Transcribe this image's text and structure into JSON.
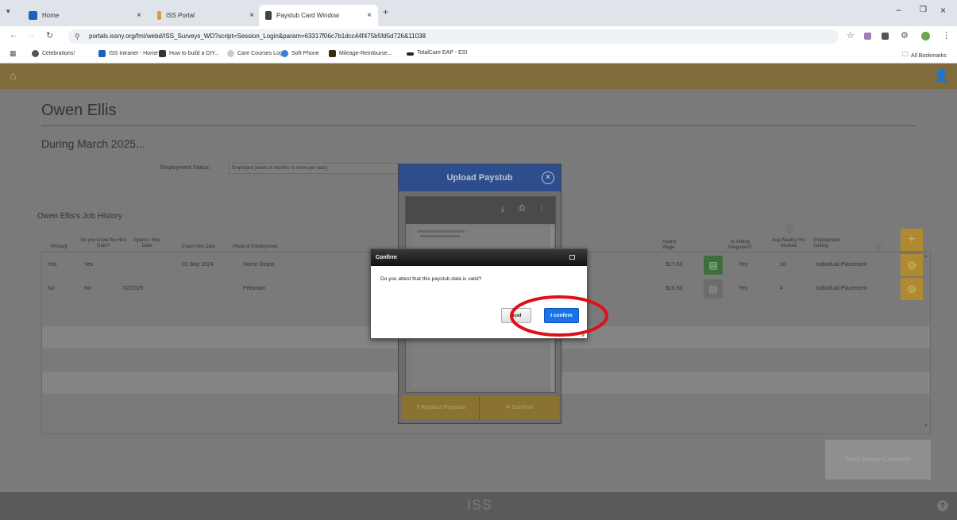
{
  "browser": {
    "tabs": [
      {
        "title": "Home"
      },
      {
        "title": "ISS Portal"
      },
      {
        "title": "Paystub Card Window"
      }
    ],
    "url": "portals.issny.org/fmi/webd/ISS_Surveys_WD?script=Session_Login&param=63317f06c7b1dcc44f475b5fd5d726&11038",
    "bookmarks": [
      "Celebrations!",
      "ISS Intranet - Home",
      "How to build a DIY...",
      "Care Courses Login",
      "Soft Phone",
      "Mileage-Reimburse...",
      "TotalCare EAP - ESI"
    ],
    "all_bookmarks": "All Bookmarks"
  },
  "page": {
    "name": "Owen Ellis",
    "period": "During March 2025...",
    "employment_status_label": "Employment Status:",
    "employment_status_value": "Employed (works 6 months or more per year)",
    "job_history_title": "Owen Ellis's Job History",
    "columns": {
      "primary": "Primary",
      "know_hire": "Do you know the Hire Date?",
      "approx_hire": "Approx. Hire Date",
      "exact_hire": "Exact Hire Date",
      "place": "Place of Employment",
      "wage": "Hourly Wage",
      "integrated": "Is setting integrated?",
      "avg_hours": "Avg Weekly Hrs Worked",
      "setting": "Employment Setting"
    },
    "rows": [
      {
        "primary": "Yes",
        "know": "Yes",
        "approx": "",
        "exact": "01 Sep 2024",
        "place": "Home Depot",
        "wage": "$17.50",
        "integrated": "Yes",
        "hours": "10",
        "setting": "Individual Placement"
      },
      {
        "primary": "No",
        "know": "No",
        "approx": "02/2025",
        "exact": "",
        "place": "Petsmart",
        "wage": "$16.50",
        "integrated": "Yes",
        "hours": "4",
        "setting": "Individual Placement"
      }
    ],
    "mark_complete": "Mark Survey Complete",
    "footer_logo": "ISS"
  },
  "upload_modal": {
    "title": "Upload Paystub",
    "replace_label": "Replace Paystub",
    "confirm_label": "Confirm"
  },
  "confirm_dialog": {
    "title": "Confirm",
    "message": "Do you attest that this paystub data is valid?",
    "cancel_label": "ncel",
    "confirm_label": "I confirm"
  },
  "colors": {
    "header": "#7f6b3c",
    "gold": "#b08a2e",
    "modal_header": "#2d4d8c",
    "primary_button": "#1a73e8",
    "annotation": "#e0101a"
  }
}
